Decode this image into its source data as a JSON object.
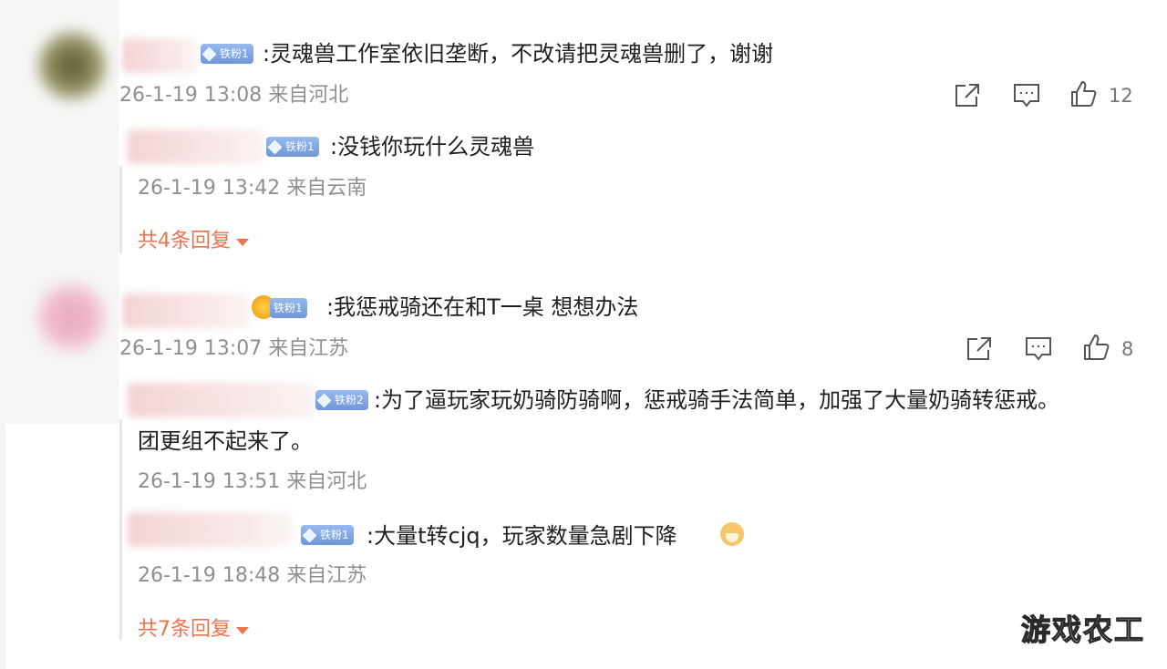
{
  "comments": [
    {
      "badge": "铁粉1",
      "text": ":灵魂兽工作室依旧垄断，不改请把灵魂兽删了，谢谢",
      "meta": "26-1-19 13:08 来自河北",
      "likes": "12",
      "replies": [
        {
          "badge": "铁粉1",
          "text": ":没钱你玩什么灵魂兽",
          "meta": "26-1-19 13:42 来自云南"
        }
      ],
      "more_replies": "共4条回复"
    },
    {
      "badge": "铁粉1",
      "text": ":我惩戒骑还在和T一桌 想想办法",
      "meta": "26-1-19 13:07 来自江苏",
      "likes": "8",
      "replies": [
        {
          "badge": "铁粉2",
          "text_line1": ":为了逼玩家玩奶骑防骑啊，惩戒骑手法简单，加强了大量奶骑转惩戒。",
          "text_line2": "团更组不起来了。",
          "meta": "26-1-19 13:51 来自河北"
        },
        {
          "badge": "铁粉1",
          "text": ":大量t转cjq，玩家数量急剧下降",
          "meta": "26-1-19 18:48 来自江苏",
          "emoji": "doge-emoji"
        }
      ],
      "more_replies": "共7条回复"
    }
  ],
  "icons": {
    "share": "share-icon",
    "comment": "comment-icon",
    "like": "thumbs-up-icon"
  },
  "colors": {
    "more_link": "#eb7350",
    "meta": "#8f8f8f",
    "badge": "#7aa0e0"
  },
  "watermark": "游戏农工"
}
